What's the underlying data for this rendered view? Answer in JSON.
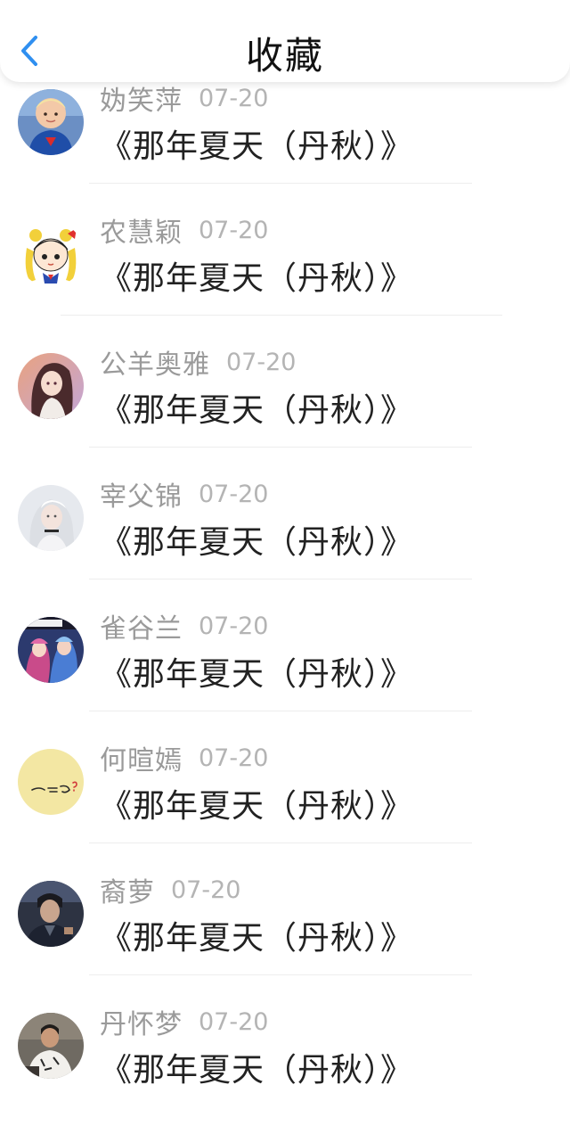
{
  "header": {
    "title": "收藏",
    "back_icon": "chevron-left-icon",
    "accent": "#2f8ff0"
  },
  "items": [
    {
      "name": "妫笑萍",
      "date": "07-20",
      "work": "《那年夏天（丹秋）》",
      "avatar": "boy-superman-avatar"
    },
    {
      "name": "农慧颖",
      "date": "07-20",
      "work": "《那年夏天（丹秋）》",
      "avatar": "sailor-moon-avatar"
    },
    {
      "name": "公羊奥雅",
      "date": "07-20",
      "work": "《那年夏天（丹秋）》",
      "avatar": "anime-girl-avatar"
    },
    {
      "name": "宰父锦",
      "date": "07-20",
      "work": "《那年夏天（丹秋）》",
      "avatar": "white-hair-girl-avatar"
    },
    {
      "name": "雀谷兰",
      "date": "07-20",
      "work": "《那年夏天（丹秋）》",
      "avatar": "game-characters-avatar"
    },
    {
      "name": "何暄嫣",
      "date": "07-20",
      "work": "《那年夏天（丹秋）》",
      "avatar": "yellow-sketch-avatar"
    },
    {
      "name": "裔萝",
      "date": "07-20",
      "work": "《那年夏天（丹秋）》",
      "avatar": "dark-jacket-man-avatar"
    },
    {
      "name": "丹怀梦",
      "date": "07-20",
      "work": "《那年夏天（丹秋）》",
      "avatar": "man-white-shirt-avatar"
    }
  ]
}
